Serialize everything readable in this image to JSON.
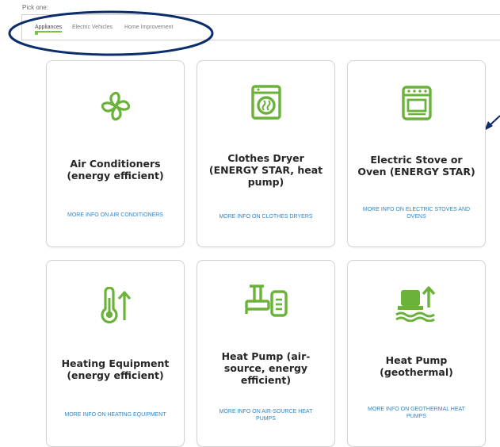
{
  "picker": {
    "label": "Pick one:",
    "tabs": [
      {
        "label": "Appliances",
        "active": true
      },
      {
        "label": "Electric Vehicles",
        "active": false
      },
      {
        "label": "Home Improvement",
        "active": false
      }
    ]
  },
  "accent_color": "#6bb23a",
  "link_color": "#2f86c5",
  "annotation_color": "#0c2d6b",
  "cards": [
    {
      "icon": "fan-icon",
      "title": "Air Conditioners (energy efficient)",
      "link": "MORE INFO ON AIR CONDITIONERS"
    },
    {
      "icon": "dryer-icon",
      "title": "Clothes Dryer (ENERGY STAR, heat pump)",
      "link": "MORE INFO ON CLOTHES DRYERS"
    },
    {
      "icon": "oven-icon",
      "title": "Electric Stove or Oven (ENERGY STAR)",
      "link": "MORE INFO ON ELECTRIC STOVES AND OVENS"
    },
    {
      "icon": "thermometer-up-icon",
      "title": "Heating Equipment (energy efficient)",
      "link": "MORE INFO ON HEATING EQUIPMENT"
    },
    {
      "icon": "heat-pump-air-icon",
      "title": "Heat Pump (air-source, energy efficient)",
      "link": "MORE INFO ON AIR-SOURCE HEAT PUMPS"
    },
    {
      "icon": "heat-pump-geothermal-icon",
      "title": "Heat Pump (geothermal)",
      "link": "MORE INFO ON GEOTHERMAL HEAT PUMPS"
    }
  ]
}
